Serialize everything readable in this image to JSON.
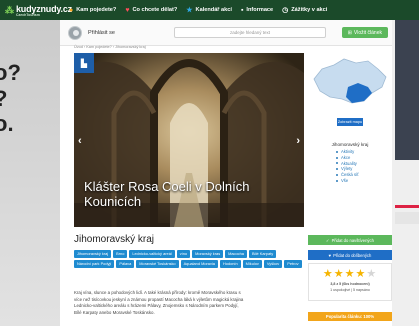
{
  "background": {
    "left_words": [
      "o?",
      "?",
      "o."
    ]
  },
  "nav": {
    "logo_text": "kudyznudy.cz",
    "logo_subtitle": "CzechTourism",
    "items": [
      {
        "icon": "map-pin-icon",
        "label": "Kam pojedete?"
      },
      {
        "icon": "heart-icon",
        "label": "Co chcete dělat?"
      },
      {
        "icon": "star-icon",
        "label": "Kalendář akcí"
      },
      {
        "icon": "info-icon",
        "label": "Informace"
      },
      {
        "icon": "clock-icon",
        "label": "Zážitky v akci"
      }
    ]
  },
  "subbar": {
    "login_label": "Přihlásit se",
    "search_placeholder": "zadejte hledaný text",
    "add_button": "Vložit článek"
  },
  "breadcrumb": "Úvod › Kam pojedete? › Jihomoravský kraj",
  "hero": {
    "caption": "Klášter Rosa Coeli v Dolních Kounicích",
    "prev_arrow": "‹",
    "next_arrow": "›",
    "tag_icon": "camera-icon"
  },
  "region": {
    "title": "Jihomoravský kraj",
    "tags": [
      "Jihomoravský kraj",
      "Brno",
      "Lednicko-valtický areál",
      "víno",
      "Moravský kras",
      "Macocha",
      "Bílé Karpaty",
      "Národní park Podyjí",
      "Pálava",
      "Moravské Toskánsko",
      "Aqualand Moravia",
      "Hodonín",
      "Mikulov",
      "Vyškov",
      "Petrov"
    ],
    "description": "Kraj vína, slunce a pohodových lidí. A také krásná přírody: kromě Moravského krasu s více než tisícovkou jeskyní a známou propastí Macocha láká k výletům magická krajina Lednicko-valtického areálu s hrázemi Pálavy, Znojemsko s Národním parkem Podyjí, Bílé Karpaty anebo Moravské Toskánsko."
  },
  "sidebar": {
    "map_button": "Zobrazit mapu",
    "title": "Jihomoravský kraj",
    "links": [
      "Aktivity",
      "Akce",
      "Aktuality",
      "Výlety",
      "Česká síť",
      "Vše"
    ],
    "add_favorites": "Přidat do navštívených",
    "add_likes": "Přidat do oblíbených",
    "rating_text": "3,8 z 5 (6ks hodnocení)",
    "rating_sub": "1 uspokojivé | 5 napsáno",
    "rating_value": 4,
    "rating_max": 5,
    "popularity": "Popularita článku: 100%"
  },
  "colors": {
    "nav_bg": "#1b4a2a",
    "accent_blue": "#1f8bd0",
    "button_green": "#5cb85c",
    "button_blue": "#1f6ec6",
    "popularity_orange": "#f2a51a"
  }
}
